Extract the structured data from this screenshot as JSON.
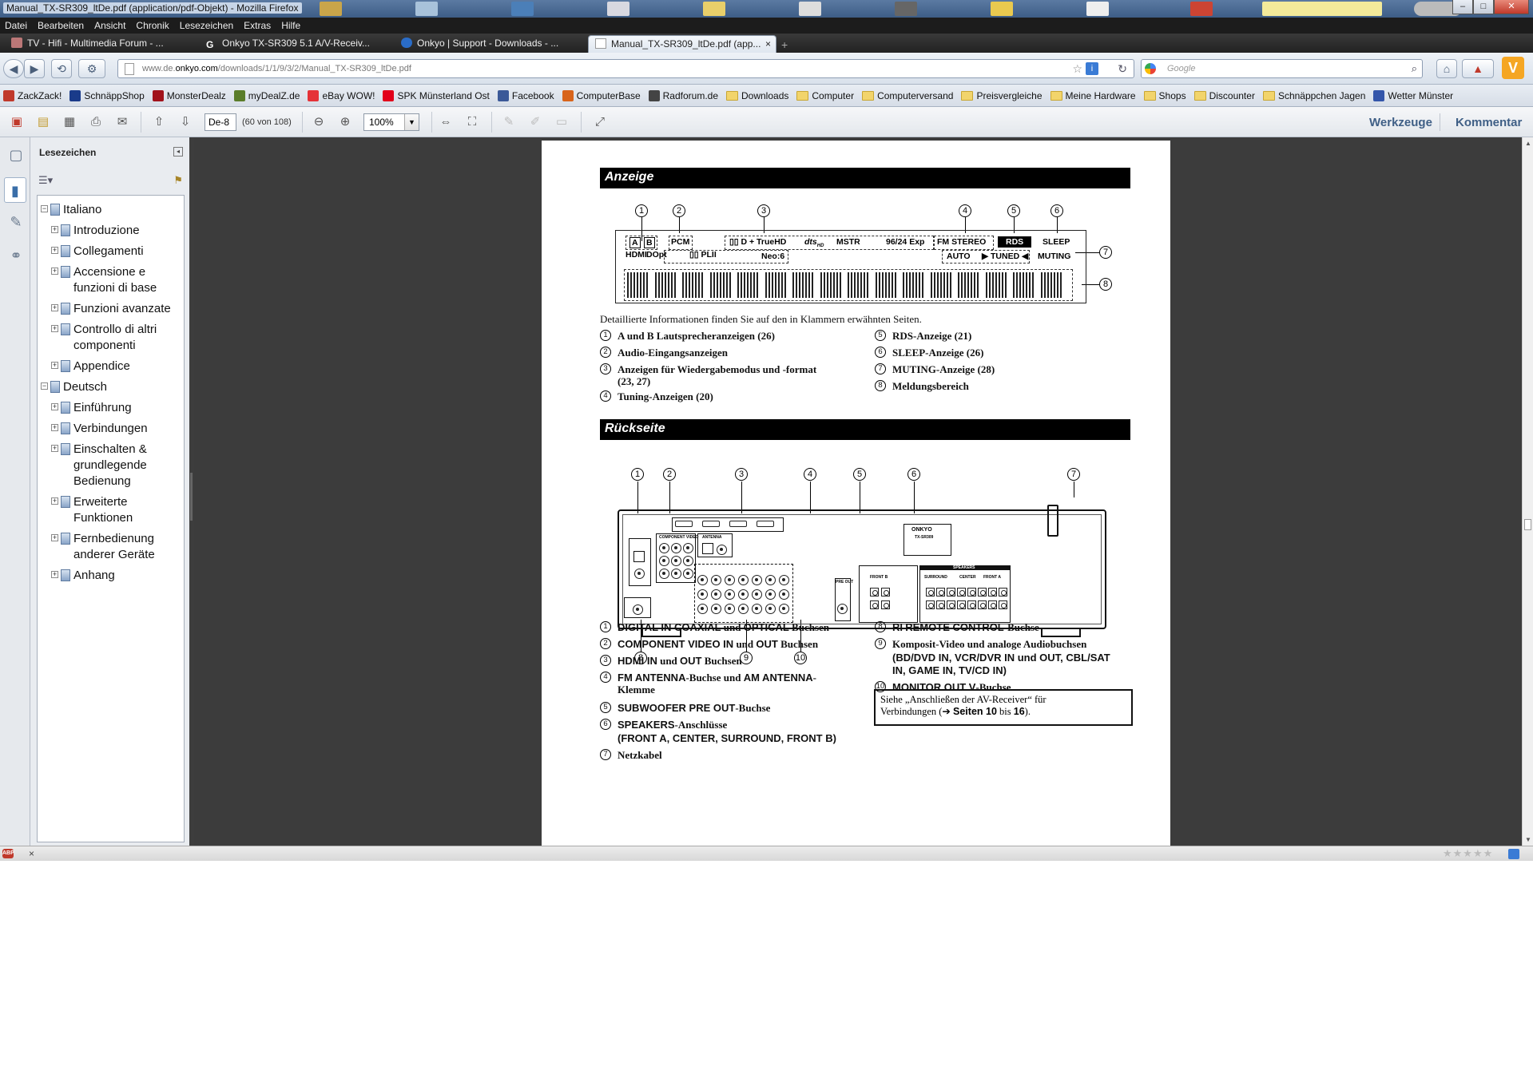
{
  "window": {
    "title": "Manual_TX-SR309_ltDe.pdf (application/pdf-Objekt) - Mozilla Firefox",
    "controls": {
      "minimize": "–",
      "maximize": "□",
      "close": "✕"
    }
  },
  "menu": [
    "Datei",
    "Bearbeiten",
    "Ansicht",
    "Chronik",
    "Lesezeichen",
    "Extras",
    "Hilfe"
  ],
  "tabs": [
    {
      "label": "TV - Hifi - Multimedia Forum - ...",
      "active": false
    },
    {
      "label": "Onkyo TX-SR309 5.1 A/V-Receiv...",
      "active": false
    },
    {
      "label": "Onkyo | Support - Downloads - ...",
      "active": false
    },
    {
      "label": "Manual_TX-SR309_ltDe.pdf (app...",
      "active": true,
      "close": "×"
    }
  ],
  "newtab": "+",
  "nav": {
    "url_prefix": "www.de.",
    "url_domain": "onkyo.com",
    "url_path": "/downloads/1/1/9/3/2/Manual_TX-SR309_ltDe.pdf",
    "search_placeholder": "Google"
  },
  "bookmarks": [
    {
      "label": "ZackZack!",
      "color": "#c0392b",
      "type": "site"
    },
    {
      "label": "SchnäppShop",
      "color": "#1a3b8a",
      "type": "site"
    },
    {
      "label": "MonsterDealz",
      "color": "#a1121b",
      "type": "site"
    },
    {
      "label": "myDealZ.de",
      "color": "#5a7d2a",
      "type": "site"
    },
    {
      "label": "eBay WOW!",
      "color": "#e53238",
      "type": "site"
    },
    {
      "label": "SPK Münsterland Ost",
      "color": "#e2001a",
      "type": "site"
    },
    {
      "label": "Facebook",
      "color": "#3b5998",
      "type": "site"
    },
    {
      "label": "ComputerBase",
      "color": "#d8641b",
      "type": "site"
    },
    {
      "label": "Radforum.de",
      "color": "#444444",
      "type": "site"
    },
    {
      "label": "Downloads",
      "type": "folder"
    },
    {
      "label": "Computer",
      "type": "folder"
    },
    {
      "label": "Computerversand",
      "type": "folder"
    },
    {
      "label": "Preisvergleiche",
      "type": "folder"
    },
    {
      "label": "Meine Hardware",
      "type": "folder"
    },
    {
      "label": "Shops",
      "type": "folder"
    },
    {
      "label": "Discounter",
      "type": "folder"
    },
    {
      "label": "Schnäppchen Jagen",
      "type": "folder"
    },
    {
      "label": "Wetter Münster",
      "color": "#3355aa",
      "type": "site"
    }
  ],
  "reader": {
    "page_input": "De-8",
    "page_count": "(60 von 108)",
    "zoom": "100%",
    "tools": "Werkzeuge",
    "comment": "Kommentar"
  },
  "panel": {
    "title": "Lesezeichen",
    "tree": [
      {
        "label": "Italiano",
        "level": 0,
        "expanded": true
      },
      {
        "label": "Introduzione",
        "level": 1
      },
      {
        "label": "Collegamenti",
        "level": 1
      },
      {
        "label": "Accensione e\nfunzioni di base",
        "level": 1
      },
      {
        "label": "Funzioni avanzate",
        "level": 1
      },
      {
        "label": "Controllo di altri\ncomponenti",
        "level": 1
      },
      {
        "label": "Appendice",
        "level": 1
      },
      {
        "label": "Deutsch",
        "level": 0,
        "expanded": true
      },
      {
        "label": "Einführung",
        "level": 1
      },
      {
        "label": "Verbindungen",
        "level": 1
      },
      {
        "label": "Einschalten &\ngrundlegende\nBedienung",
        "level": 1
      },
      {
        "label": "Erweiterte\nFunktionen",
        "level": 1
      },
      {
        "label": "Fernbedienung\nanderer Geräte",
        "level": 1
      },
      {
        "label": "Anhang",
        "level": 1
      }
    ]
  },
  "pdf": {
    "section1_title": "Anzeige",
    "display": {
      "callouts": [
        "1",
        "2",
        "3",
        "4",
        "5",
        "6",
        "7",
        "8"
      ],
      "labels": {
        "a": "A",
        "b": "B",
        "hdmi": "HDMI",
        "dopt": "DOpt",
        "pcm": "PCM",
        "truehd": "D + TrueHD",
        "dts": "dts",
        "hd": "HD",
        "mstr": "MSTR",
        "exp": "96/24 Exp",
        "pliii": "PL",
        "pliii_suffix": "II",
        "neo": "Neo:6",
        "fmstereo": "FM STEREO",
        "rds": "RDS",
        "sleep": "SLEEP",
        "auto": "AUTO",
        "tuned": "TUNED",
        "muting": "MUTING"
      }
    },
    "intro": "Detaillierte Informationen finden Sie auf den in Klammern erwähnten Seiten.",
    "display_legend_left": [
      {
        "n": "1",
        "text": "A und B Lautsprecheranzeigen (26)"
      },
      {
        "n": "2",
        "text": "Audio-Eingangsanzeigen"
      },
      {
        "n": "3",
        "text": "Anzeigen für Wiedergabemodus und -format",
        "text2": "(23, 27)"
      },
      {
        "n": "4",
        "text": "Tuning-Anzeigen (20)"
      }
    ],
    "display_legend_right": [
      {
        "n": "5",
        "text": "RDS-Anzeige (21)"
      },
      {
        "n": "6",
        "text": "SLEEP-Anzeige (26)"
      },
      {
        "n": "7",
        "text": "MUTING-Anzeige (28)"
      },
      {
        "n": "8",
        "text": "Meldungsbereich"
      }
    ],
    "section2_title": "Rückseite",
    "rear": {
      "callouts_top": [
        "1",
        "2",
        "3",
        "4",
        "5",
        "6",
        "7"
      ],
      "callouts_bottom": [
        "8",
        "9",
        "10"
      ],
      "brand": "ONKYO",
      "model": "TX-SR309",
      "labels": {
        "component": "COMPONENT VIDEO",
        "antenna": "ANTENNA",
        "speakers": "SPEAKERS",
        "surround": "SURROUND",
        "center": "CENTER",
        "fronta": "FRONT A",
        "frontb": "FRONT B",
        "preout": "PRE OUT",
        "r": "R",
        "l": "L"
      }
    },
    "rear_legend_left": [
      {
        "n": "1",
        "bold": "DIGITAL IN COAXIAL",
        "mid": " und ",
        "bold2": "OPTICAL",
        "rest": " Buchsen"
      },
      {
        "n": "2",
        "bold": "COMPONENT VIDEO IN",
        "mid": " und ",
        "bold2": "OUT",
        "rest": " Buchsen"
      },
      {
        "n": "3",
        "bold": "HDMI IN",
        "mid": " und ",
        "bold2": "OUT",
        "rest": " Buchsen"
      },
      {
        "n": "4",
        "bold": "FM ANTENNA",
        "mid": "-Buchse und ",
        "bold2": "AM ANTENNA",
        "rest": "-",
        "line2": "Klemme"
      },
      {
        "n": "5",
        "bold": "SUBWOOFER PRE OUT",
        "mid": "-Buchse",
        "bold2": "",
        "rest": ""
      },
      {
        "n": "6",
        "bold": "SPEAKERS",
        "mid": "-Anschlüsse",
        "bold2": "",
        "rest": "",
        "line2sans": "(FRONT A, CENTER, SURROUND, FRONT B)"
      },
      {
        "n": "7",
        "bold": "",
        "mid": "Netzkabel",
        "bold2": "",
        "rest": ""
      }
    ],
    "rear_legend_right": [
      {
        "n": "8",
        "bold": "RI",
        "mid": " ",
        "bold2": "REMOTE CONTROL",
        "rest": "-Buchse"
      },
      {
        "n": "9",
        "bold": "",
        "mid": "Komposit-Video und analoge Audiobuchsen",
        "bold2": "",
        "rest": "",
        "line2sans": "(BD/DVD IN, VCR/DVR IN und OUT, CBL/SAT",
        "line3sans": "IN, GAME IN, TV/CD IN)"
      },
      {
        "n": "10",
        "bold": "MONITOR OUT V",
        "mid": "-Buchse",
        "bold2": "",
        "rest": ""
      }
    ],
    "note_line1": "Siehe „Anschließen der AV-Receiver“ für",
    "note_line2a": "Verbindungen (➔ ",
    "note_line2b": "Seiten 10",
    "note_line2c": " bis ",
    "note_line2d": "16",
    "note_line2e": ")."
  },
  "statusbar": {
    "abp": "ABP",
    "close": "×",
    "stars": "★★★★★"
  }
}
